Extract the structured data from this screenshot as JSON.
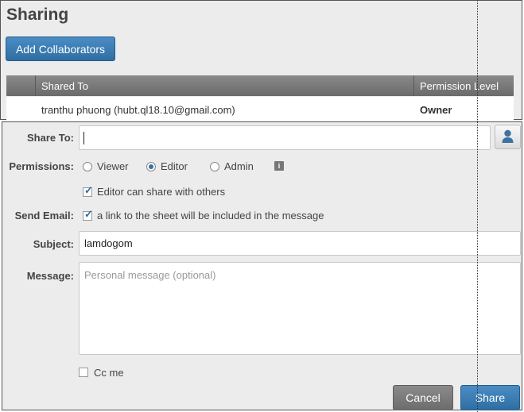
{
  "sharing": {
    "title": "Sharing",
    "add_button_label": "Add Collaborators",
    "table": {
      "columns": [
        "Shared To",
        "Permission Level"
      ],
      "rows": [
        {
          "shared_to": "tranthu phuong (hubt.ql18.10@gmail.com)",
          "permission": "Owner"
        }
      ]
    }
  },
  "form": {
    "share_to_label": "Share To:",
    "share_to_value": "",
    "contact_icon": "person-icon",
    "permissions_label": "Permissions:",
    "permission_options": [
      "Viewer",
      "Editor",
      "Admin"
    ],
    "permission_selected": "Editor",
    "info_icon": "info-icon",
    "editor_share_label": "Editor can share with others",
    "editor_share_checked": true,
    "send_email_label": "Send Email:",
    "send_email_text": "a link to the sheet will be included in the message",
    "send_email_checked": true,
    "subject_label": "Subject:",
    "subject_value": "lamdogom",
    "message_label": "Message:",
    "message_placeholder": "Personal message (optional)",
    "cc_label": "Cc me",
    "cc_checked": false,
    "cancel_label": "Cancel",
    "share_label": "Share"
  },
  "colors": {
    "primary_button": "#3a7db5",
    "secondary_button": "#7a7a7a",
    "panel_bg": "#ececec"
  }
}
